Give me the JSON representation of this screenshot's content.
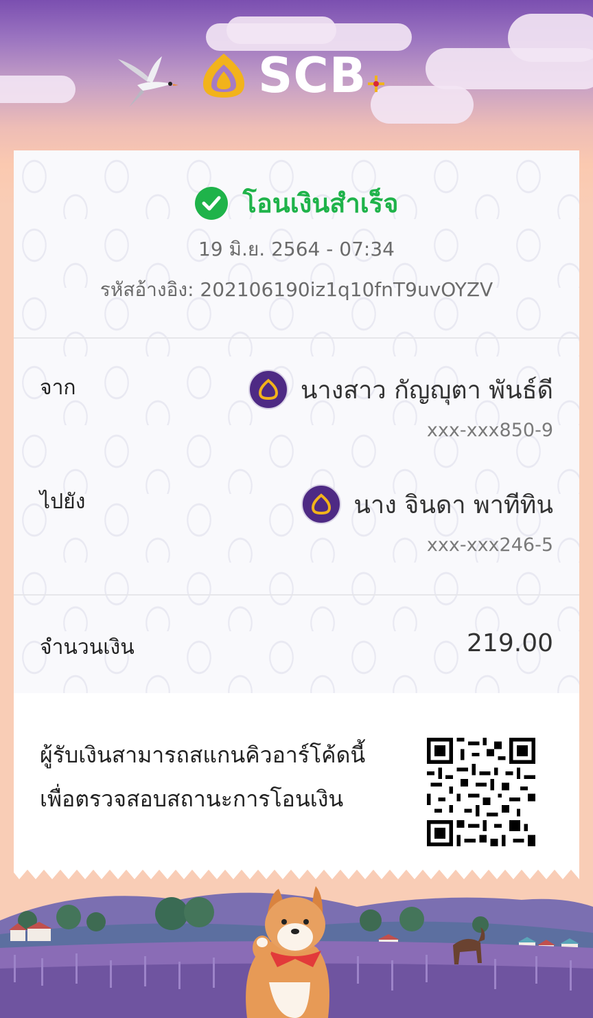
{
  "header": {
    "brand": "SCB"
  },
  "status": {
    "title": "โอนเงินสำเร็จ",
    "datetime": "19 มิ.ย. 2564 - 07:34",
    "reference": "รหัสอ้างอิง: 202106190iz1q10fnT9uvOYZV"
  },
  "from": {
    "label": "จาก",
    "name": "นางสาว กัญญุตา พันธ์ดี",
    "account": "xxx-xxx850-9"
  },
  "to": {
    "label": "ไปยัง",
    "name": "นาง จินดา พาทีทิน",
    "account": "xxx-xxx246-5"
  },
  "amount": {
    "label": "จำนวนเงิน",
    "value": "219.00"
  },
  "qr": {
    "note_line1": "ผู้รับเงินสามารถสแกนคิวอาร์โค้ดนี้",
    "note_line2": "เพื่อตรวจสอบสถานะการโอนเงิน"
  },
  "colors": {
    "success": "#1fb34a",
    "brand_purple": "#4e2a84",
    "brand_gold": "#f2b31b",
    "background_peach": "#f9cdb6"
  }
}
